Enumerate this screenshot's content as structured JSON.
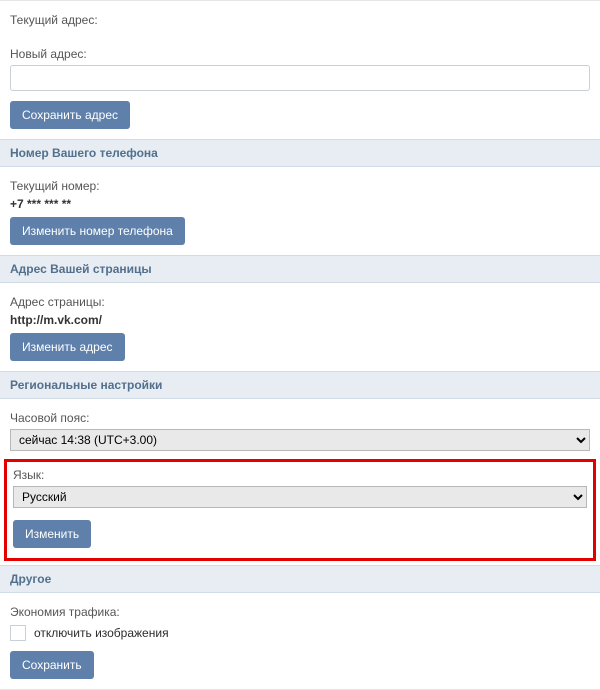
{
  "email": {
    "current_label": "Текущий адрес:",
    "new_label": "Новый адрес:",
    "new_value": "",
    "save_btn": "Сохранить адрес"
  },
  "phone": {
    "header": "Номер Вашего телефона",
    "current_label": "Текущий номер:",
    "current_value": "+7 *** *** **",
    "change_btn": "Изменить номер телефона"
  },
  "page_address": {
    "header": "Адрес Вашей страницы",
    "label": "Адрес страницы:",
    "value": "http://m.vk.com/",
    "change_btn": "Изменить адрес"
  },
  "regional": {
    "header": "Региональные настройки",
    "timezone_label": "Часовой пояс:",
    "timezone_value": "сейчас 14:38 (UTC+3.00)",
    "language_label": "Язык:",
    "language_value": "Русский",
    "change_btn": "Изменить"
  },
  "other": {
    "header": "Другое",
    "traffic_label": "Экономия трафика:",
    "checkbox_label": "отключить изображения",
    "save_btn": "Сохранить"
  }
}
